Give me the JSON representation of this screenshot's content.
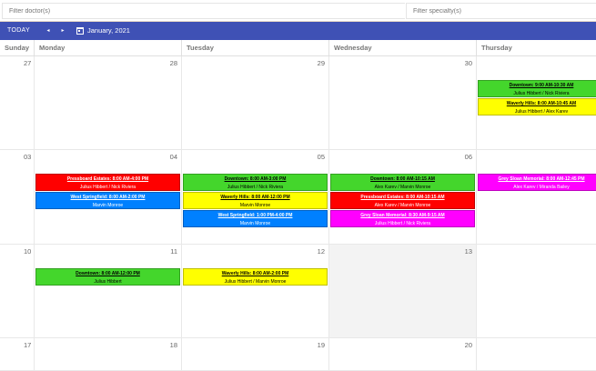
{
  "filters": {
    "doctor_placeholder": "Filter doctor(s)",
    "specialty_placeholder": "Filter specialty(s)"
  },
  "toolbar": {
    "today_label": "TODAY",
    "prev_glyph": "◂",
    "next_glyph": "▸",
    "date_label": "January, 2021"
  },
  "colors": {
    "toolbar": "#3f51b5",
    "red": "#ff0000",
    "green": "#44d62c",
    "yellow": "#ffff00",
    "blue": "#0080ff",
    "magenta": "#ff00ff"
  },
  "day_headers": [
    "Sunday",
    "Monday",
    "Tuesday",
    "Wednesday",
    "Thursday"
  ],
  "weeks": [
    {
      "days": [
        "27",
        "28",
        "29",
        "30",
        ""
      ]
    },
    {
      "days": [
        "03",
        "04",
        "05",
        "06",
        ""
      ]
    },
    {
      "days": [
        "10",
        "11",
        "12",
        "13",
        ""
      ]
    },
    {
      "days": [
        "17",
        "18",
        "19",
        "20",
        ""
      ]
    }
  ],
  "appointments": [
    {
      "week": 0,
      "day": 4,
      "slot": 0,
      "color": "green",
      "text_color": "#000000",
      "title": "Downtown: 9:00 AM-10:30 AM",
      "doctors": "Julius Hibbert / Nick Riviera"
    },
    {
      "week": 0,
      "day": 4,
      "slot": 1,
      "color": "yellow",
      "text_color": "#000000",
      "title": "Waverly Hills: 8:00 AM-10:45 AM",
      "doctors": "Julius Hibbert / Alex Karev"
    },
    {
      "week": 1,
      "day": 1,
      "slot": 0,
      "color": "red",
      "text_color": "#ffffff",
      "title": "Pressboard Estates: 8:00 AM-4:00 PM",
      "doctors": "Julius Hibbert / Nick Riviera"
    },
    {
      "week": 1,
      "day": 1,
      "slot": 1,
      "color": "blue",
      "text_color": "#ffffff",
      "title": "West Springfield: 8:00 AM-2:00 PM",
      "doctors": "Marvin Monroe"
    },
    {
      "week": 1,
      "day": 2,
      "slot": 0,
      "color": "green",
      "text_color": "#000000",
      "title": "Downtown: 8:00 AM-3:00 PM",
      "doctors": "Julius Hibbert / Nick Riviera"
    },
    {
      "week": 1,
      "day": 2,
      "slot": 1,
      "color": "yellow",
      "text_color": "#000000",
      "title": "Waverly Hills: 8:00 AM-12:00 PM",
      "doctors": "Marvin Monroe"
    },
    {
      "week": 1,
      "day": 2,
      "slot": 2,
      "color": "blue",
      "text_color": "#ffffff",
      "title": "West Springfield: 1:00 PM-4:00 PM",
      "doctors": "Marvin Monroe"
    },
    {
      "week": 1,
      "day": 3,
      "slot": 0,
      "color": "green",
      "text_color": "#000000",
      "title": "Downtown: 8:00 AM-10:15 AM",
      "doctors": "Alex Karev / Marvin Monroe"
    },
    {
      "week": 1,
      "day": 3,
      "slot": 1,
      "color": "red",
      "text_color": "#ffffff",
      "title": "Pressboard Estates: 8:00 AM-10:15 AM",
      "doctors": "Alex Karev / Marvin Monroe"
    },
    {
      "week": 1,
      "day": 3,
      "slot": 2,
      "color": "magenta",
      "text_color": "#ffffff",
      "title": "Grey Sloan Memorial: 8:30 AM-9:15 AM",
      "doctors": "Julius Hibbert / Nick Riviera"
    },
    {
      "week": 1,
      "day": 4,
      "slot": 0,
      "color": "magenta",
      "text_color": "#ffffff",
      "title": "Grey Sloan Memorial: 8:00 AM-12:45 PM",
      "doctors": "Alex Karev / Miranda Bailey"
    },
    {
      "week": 2,
      "day": 1,
      "slot": 0,
      "color": "green",
      "text_color": "#000000",
      "title": "Downtown: 8:00 AM-12:00 PM",
      "doctors": "Julius Hibbert"
    },
    {
      "week": 2,
      "day": 2,
      "slot": 0,
      "color": "yellow",
      "text_color": "#000000",
      "title": "Waverly Hills: 8:00 AM-2:00 PM",
      "doctors": "Julius Hibbert / Marvin Monroe"
    }
  ]
}
